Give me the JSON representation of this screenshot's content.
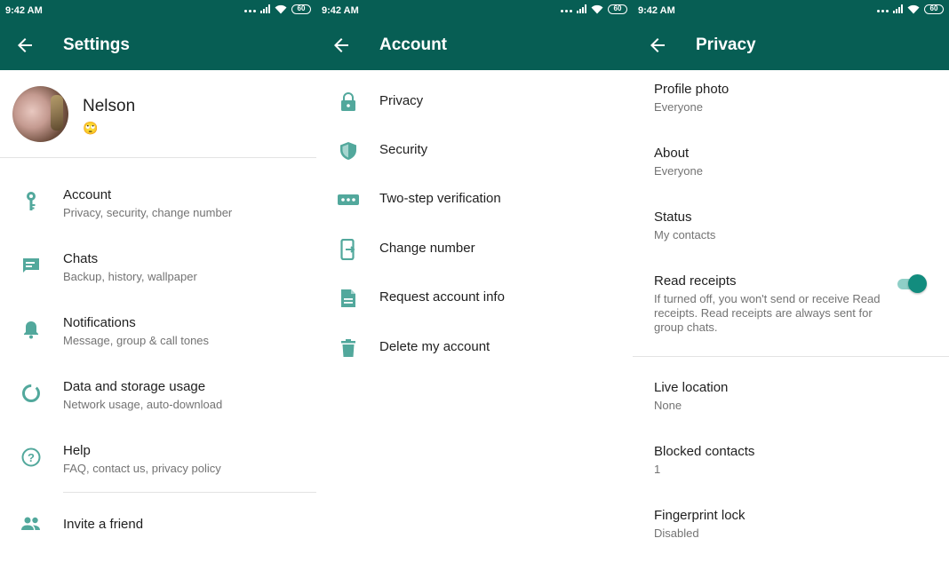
{
  "colors": {
    "primary": "#075e54",
    "icon": "#52a89c",
    "toggle_on": "#128c7e"
  },
  "statusbar": {
    "time": "9:42 AM",
    "battery": "60"
  },
  "settings": {
    "title": "Settings",
    "profile": {
      "name": "Nelson",
      "status_emoji": "🙄"
    },
    "items": [
      {
        "label": "Account",
        "sub": "Privacy, security, change number",
        "icon": "key-icon"
      },
      {
        "label": "Chats",
        "sub": "Backup, history, wallpaper",
        "icon": "chat-icon"
      },
      {
        "label": "Notifications",
        "sub": "Message, group & call tones",
        "icon": "bell-icon"
      },
      {
        "label": "Data and storage usage",
        "sub": "Network usage, auto-download",
        "icon": "data-usage-icon"
      },
      {
        "label": "Help",
        "sub": "FAQ, contact us, privacy policy",
        "icon": "help-icon"
      }
    ],
    "invite": {
      "label": "Invite a friend",
      "icon": "people-icon"
    }
  },
  "account": {
    "title": "Account",
    "items": [
      {
        "label": "Privacy",
        "icon": "lock-icon"
      },
      {
        "label": "Security",
        "icon": "shield-icon"
      },
      {
        "label": "Two-step verification",
        "icon": "dots-icon"
      },
      {
        "label": "Change number",
        "icon": "change-number-icon"
      },
      {
        "label": "Request account info",
        "icon": "document-icon"
      },
      {
        "label": "Delete my account",
        "icon": "trash-icon"
      }
    ]
  },
  "privacy": {
    "title": "Privacy",
    "items": [
      {
        "label": "Profile photo",
        "value": "Everyone"
      },
      {
        "label": "About",
        "value": "Everyone"
      },
      {
        "label": "Status",
        "value": "My contacts"
      },
      {
        "label": "Read receipts",
        "value": "If turned off, you won't send or receive Read receipts. Read receipts are always sent for group chats.",
        "toggle_on": true
      },
      {
        "label": "Live location",
        "value": "None"
      },
      {
        "label": "Blocked contacts",
        "value": "1"
      },
      {
        "label": "Fingerprint lock",
        "value": "Disabled"
      }
    ]
  }
}
